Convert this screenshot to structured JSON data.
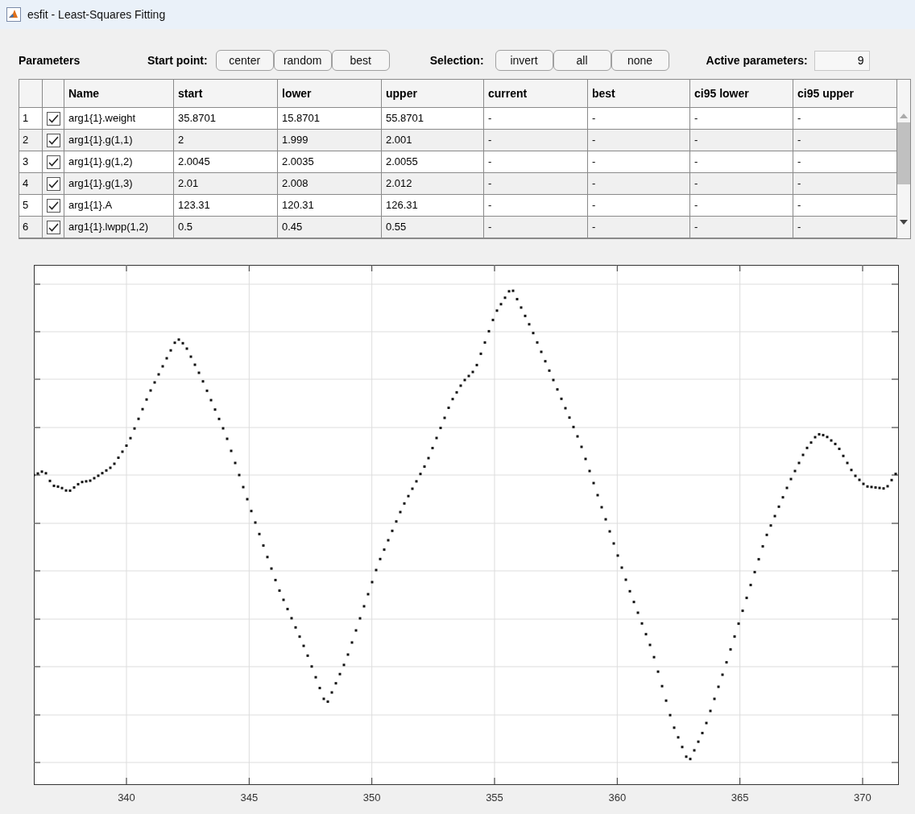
{
  "window": {
    "title": "esfit - Least-Squares Fitting"
  },
  "toolbar": {
    "section_label": "Parameters",
    "start_point_label": "Start point:",
    "start_point_buttons": [
      "center",
      "random",
      "best"
    ],
    "selection_label": "Selection:",
    "selection_buttons": [
      "invert",
      "all",
      "none"
    ],
    "active_label": "Active parameters:",
    "active_value": "9"
  },
  "table": {
    "columns": [
      "Name",
      "start",
      "lower",
      "upper",
      "current",
      "best",
      "ci95 lower",
      "ci95 upper"
    ],
    "rows": [
      {
        "index": "1",
        "checked": true,
        "cells": [
          "arg1{1}.weight",
          "35.8701",
          "15.8701",
          "55.8701",
          "-",
          "-",
          "-",
          "-"
        ]
      },
      {
        "index": "2",
        "checked": true,
        "cells": [
          "arg1{1}.g(1,1)",
          "2",
          "1.999",
          "2.001",
          "-",
          "-",
          "-",
          "-"
        ]
      },
      {
        "index": "3",
        "checked": true,
        "cells": [
          "arg1{1}.g(1,2)",
          "2.0045",
          "2.0035",
          "2.0055",
          "-",
          "-",
          "-",
          "-"
        ]
      },
      {
        "index": "4",
        "checked": true,
        "cells": [
          "arg1{1}.g(1,3)",
          "2.01",
          "2.008",
          "2.012",
          "-",
          "-",
          "-",
          "-"
        ]
      },
      {
        "index": "5",
        "checked": true,
        "cells": [
          "arg1{1}.A",
          "123.31",
          "120.31",
          "126.31",
          "-",
          "-",
          "-",
          "-"
        ]
      },
      {
        "index": "6",
        "checked": true,
        "cells": [
          "arg1{1}.lwpp(1,2)",
          "0.5",
          "0.45",
          "0.55",
          "-",
          "-",
          "-",
          "-"
        ]
      }
    ]
  },
  "plot": {
    "x_tick_labels": [
      "340",
      "345",
      "350",
      "355",
      "360",
      "365",
      "370"
    ]
  }
}
